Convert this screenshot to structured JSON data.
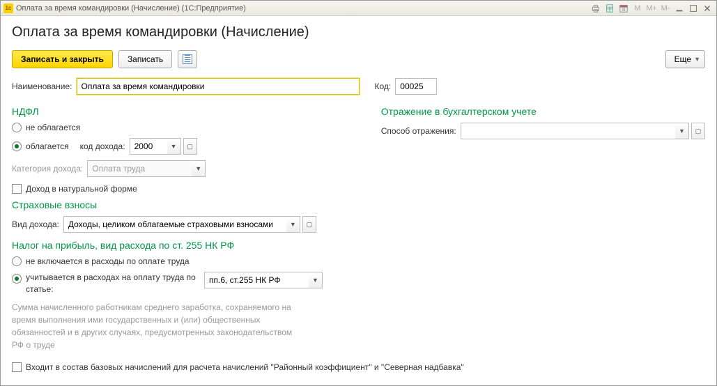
{
  "window": {
    "title": "Оплата за время командировки (Начисление)  (1С:Предприятие)"
  },
  "page_title": "Оплата за время командировки (Начисление)",
  "toolbar": {
    "save_close": "Записать и закрыть",
    "save": "Записать",
    "more": "Еще"
  },
  "fields": {
    "name_label": "Наименование:",
    "name_value": "Оплата за время командировки",
    "code_label": "Код:",
    "code_value": "00025"
  },
  "ndfl": {
    "title": "НДФЛ",
    "opt_not_taxed": "не облагается",
    "opt_taxed": "облагается",
    "income_code_label": "код дохода:",
    "income_code_value": "2000",
    "category_label": "Категория дохода:",
    "category_value": "Оплата труда",
    "natural_form": "Доход в натуральной форме"
  },
  "insurance": {
    "title": "Страховые взносы",
    "type_label": "Вид дохода:",
    "type_value": "Доходы, целиком облагаемые страховыми взносами"
  },
  "profit_tax": {
    "title": "Налог на прибыль, вид расхода по ст. 255 НК РФ",
    "opt_excluded": "не включается в расходы по оплате труда",
    "opt_included": "учитывается в расходах на оплату труда по статье:",
    "article_value": "пп.6, ст.255 НК РФ",
    "note": "Сумма начисленного работникам среднего заработка, сохраняемого на время выполнения ими государственных и (или) общественных обязанностей и в других случаях, предусмотренных законодательством РФ о труде"
  },
  "accounting": {
    "title": "Отражение в бухгалтерском учете",
    "method_label": "Способ отражения:",
    "method_value": ""
  },
  "base_check": "Входит в состав базовых начислений для расчета начислений \"Районный коэффициент\" и \"Северная надбавка\""
}
